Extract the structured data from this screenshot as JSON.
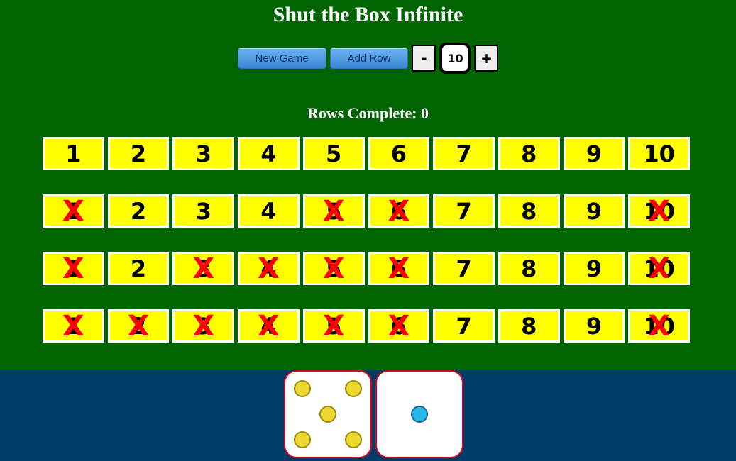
{
  "title": "Shut the Box Infinite",
  "controls": {
    "new_game_label": "New Game",
    "add_row_label": "Add Row",
    "minus_label": "-",
    "plus_label": "+",
    "box_count": "10"
  },
  "rows_complete_label": "Rows Complete: 0",
  "cross_glyph": "X",
  "rows": [
    [
      {
        "n": "1",
        "shut": false
      },
      {
        "n": "2",
        "shut": false
      },
      {
        "n": "3",
        "shut": false
      },
      {
        "n": "4",
        "shut": false
      },
      {
        "n": "5",
        "shut": false
      },
      {
        "n": "6",
        "shut": false
      },
      {
        "n": "7",
        "shut": false
      },
      {
        "n": "8",
        "shut": false
      },
      {
        "n": "9",
        "shut": false
      },
      {
        "n": "10",
        "shut": false
      }
    ],
    [
      {
        "n": "1",
        "shut": true
      },
      {
        "n": "2",
        "shut": false
      },
      {
        "n": "3",
        "shut": false
      },
      {
        "n": "4",
        "shut": false
      },
      {
        "n": "5",
        "shut": true
      },
      {
        "n": "6",
        "shut": true
      },
      {
        "n": "7",
        "shut": false
      },
      {
        "n": "8",
        "shut": false
      },
      {
        "n": "9",
        "shut": false
      },
      {
        "n": "10",
        "shut": true
      }
    ],
    [
      {
        "n": "1",
        "shut": true
      },
      {
        "n": "2",
        "shut": false
      },
      {
        "n": "3",
        "shut": true
      },
      {
        "n": "4",
        "shut": true
      },
      {
        "n": "5",
        "shut": true
      },
      {
        "n": "6",
        "shut": true
      },
      {
        "n": "7",
        "shut": false
      },
      {
        "n": "8",
        "shut": false
      },
      {
        "n": "9",
        "shut": false
      },
      {
        "n": "10",
        "shut": true
      }
    ],
    [
      {
        "n": "1",
        "shut": true
      },
      {
        "n": "2",
        "shut": true
      },
      {
        "n": "3",
        "shut": true
      },
      {
        "n": "4",
        "shut": true
      },
      {
        "n": "5",
        "shut": true
      },
      {
        "n": "6",
        "shut": true
      },
      {
        "n": "7",
        "shut": false
      },
      {
        "n": "8",
        "shut": false
      },
      {
        "n": "9",
        "shut": false
      },
      {
        "n": "10",
        "shut": true
      }
    ]
  ],
  "dice": [
    {
      "value": 5,
      "pip_color": "#ecd831"
    },
    {
      "value": 1,
      "pip_color": "#2ab8ec"
    }
  ],
  "colors": {
    "table": "#006400",
    "tray": "#003a66",
    "tile": "#ffff00",
    "cross": "#ff0000",
    "die_border": "#e00020"
  }
}
